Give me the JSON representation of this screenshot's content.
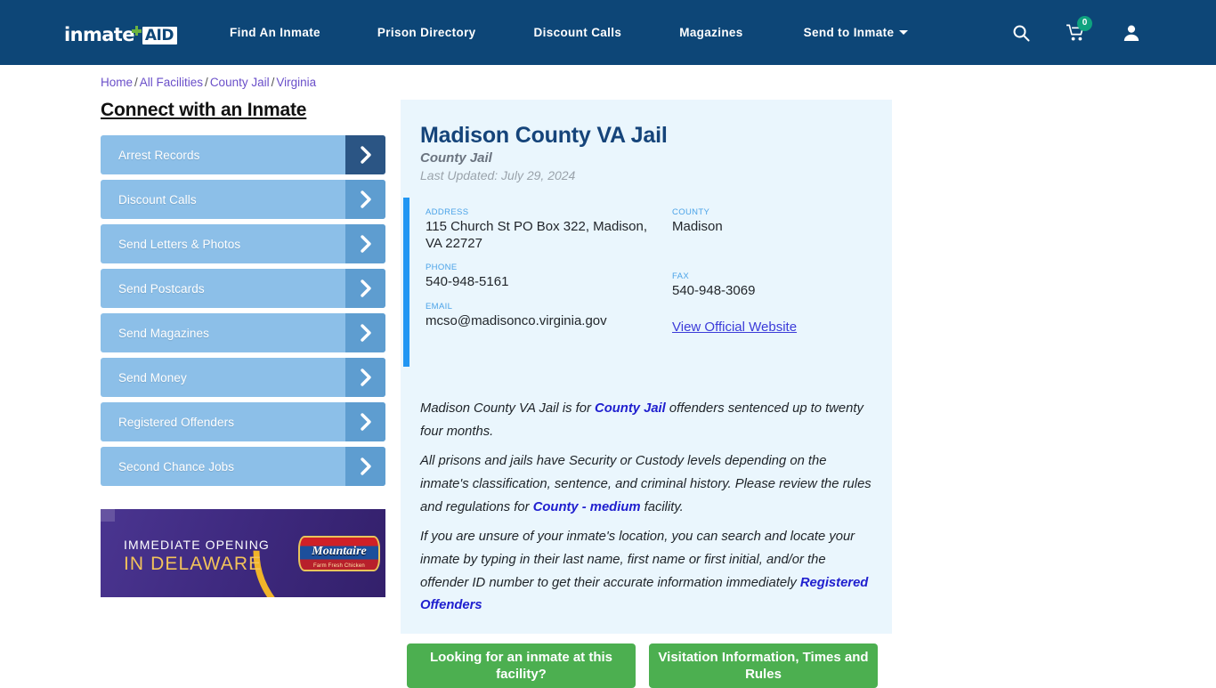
{
  "header": {
    "logo": {
      "word1": "inmate",
      "word2": "AID",
      "plus_icon": "green-plus-icon"
    },
    "nav": [
      {
        "label": "Find An Inmate"
      },
      {
        "label": "Prison Directory"
      },
      {
        "label": "Discount Calls"
      },
      {
        "label": "Magazines"
      },
      {
        "label": "Send to Inmate",
        "has_caret": true
      }
    ],
    "icons": {
      "search": "search-icon",
      "cart": "shopping-cart-icon",
      "cart_count": "0",
      "account": "user-account-icon"
    },
    "colors": {
      "background": "#0d4677",
      "badge": "#0fa37f"
    }
  },
  "breadcrumb": {
    "items": [
      "Home",
      "All Facilities",
      "County Jail",
      "Virginia"
    ],
    "separator": "/"
  },
  "sidebar": {
    "title": "Connect with an Inmate",
    "items": [
      {
        "label": "Arrest Records",
        "active": true
      },
      {
        "label": "Discount Calls",
        "active": false
      },
      {
        "label": "Send Letters & Photos",
        "active": false
      },
      {
        "label": "Send Postcards",
        "active": false
      },
      {
        "label": "Send Magazines",
        "active": false
      },
      {
        "label": "Send Money",
        "active": false
      },
      {
        "label": "Registered Offenders",
        "active": false
      },
      {
        "label": "Second Chance Jobs",
        "active": false
      }
    ],
    "ad": {
      "line1": "IMMEDIATE OPENING",
      "line2": "IN DELAWARE",
      "brand": "Mountaire",
      "brand_sub": "Farm Fresh Chicken"
    }
  },
  "facility": {
    "name": "Madison County VA Jail",
    "type": "County Jail",
    "last_updated": "Last Updated: July 29, 2024",
    "contact": {
      "address_label": "ADDRESS",
      "address_value": "115 Church St PO Box 322, Madison, VA 22727",
      "county_label": "COUNTY",
      "county_value": "Madison",
      "phone_label": "PHONE",
      "phone_value": "540-948-5161",
      "fax_label": "FAX",
      "fax_value": "540-948-3069",
      "email_label": "EMAIL",
      "email_value": "mcso@madisonco.virginia.gov",
      "website_link": "View Official Website"
    },
    "description": {
      "p1_part1": "Madison County VA Jail is for ",
      "p1_link": "County Jail",
      "p1_part2": " offenders sentenced up to twenty four months.",
      "p2_part1": "All prisons and jails have Security or Custody levels depending on the inmate's classification, sentence, and criminal history. Please review the rules and regulations for ",
      "p2_link": "County - medium",
      "p2_part2": " facility.",
      "p3_part1": "If you are unsure of your inmate's location, you can search and locate your inmate by typing in their last name, first name or first initial, and/or the offender ID number to get their accurate information immediately ",
      "p3_link": "Registered Offenders"
    },
    "colors": {
      "card_background": "#eaf6fd",
      "accent_bar": "#2196f3",
      "title": "#15447a",
      "link": "#2020cf"
    }
  },
  "cta": {
    "buttons": [
      {
        "label": "Looking for an inmate at this facility?"
      },
      {
        "label": "Visitation Information, Times and Rules"
      }
    ],
    "color": "#4caf50"
  }
}
